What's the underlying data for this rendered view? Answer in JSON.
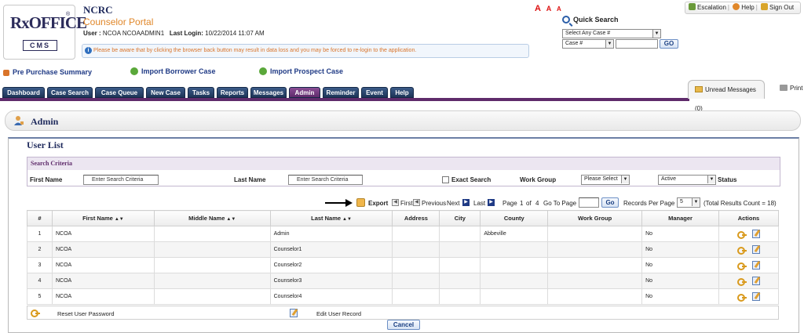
{
  "header": {
    "logo_text": "RxOFFICE",
    "logo_sub": "CMS",
    "org": "NCRC",
    "portal": "Counselor Portal",
    "user_label": "User :",
    "user_value": "NCOA NCOAADMIN1",
    "last_login_label": "Last Login:",
    "last_login_value": "10/22/2014 11:07 AM",
    "notice": "Please be aware that by clicking the browser back button may result in data loss and you may be forced to re-login to the application.",
    "font_sizes": [
      "A",
      "A",
      "A"
    ]
  },
  "quick_search": {
    "title": "Quick Search",
    "case_select": "Select Any Case #",
    "field_select": "Case #",
    "go": "GO"
  },
  "top_links": {
    "escalation": "Escalation",
    "help": "Help",
    "sign_out": "Sign Out"
  },
  "action_links": {
    "pre_purchase": "Pre Purchase Summary",
    "import_borrower": "Import Borrower Case",
    "import_prospect": "Import Prospect Case"
  },
  "nav": {
    "tabs": [
      "Dashboard",
      "Case Search",
      "Case Queue",
      "New Case",
      "Tasks",
      "Reports",
      "Messages",
      "Admin",
      "Reminder",
      "Event",
      "Help"
    ],
    "active": "Admin",
    "unread": "Unread Messages (0)",
    "print": "Print"
  },
  "page": {
    "title": "Admin",
    "section_title": "User List"
  },
  "criteria": {
    "heading": "Search Criteria",
    "first_name_label": "First Name",
    "first_name_value": "Enter Search Criteria",
    "last_name_label": "Last Name",
    "last_name_value": "Enter Search Criteria",
    "exact_search": "Exact Search",
    "work_group_label": "Work Group",
    "work_group_value": "Please Select",
    "status_value": "Active",
    "status_label": "Status"
  },
  "pager": {
    "export": "Export",
    "first": "First",
    "previous": "Previous",
    "next": "Next",
    "last": "Last",
    "page_label": "Page",
    "page_current": "1",
    "of_label": "of",
    "page_total": "4",
    "goto_label": "Go To Page",
    "go": "Go",
    "records_label": "Records Per Page",
    "records_value": "5",
    "total": "(Total Results Count = 18)"
  },
  "table": {
    "headers": [
      "#",
      "First Name",
      "Middle Name",
      "Last Name",
      "Address",
      "City",
      "County",
      "Work Group",
      "Manager",
      "Actions"
    ],
    "rows": [
      {
        "num": "1",
        "first": "NCOA",
        "middle": "",
        "last": "Admin",
        "address": "",
        "city": "",
        "county": "Abbeville",
        "group": "",
        "manager": "No"
      },
      {
        "num": "2",
        "first": "NCOA",
        "middle": "",
        "last": "Counselor1",
        "address": "",
        "city": "",
        "county": "",
        "group": "",
        "manager": "No"
      },
      {
        "num": "3",
        "first": "NCOA",
        "middle": "",
        "last": "Counselor2",
        "address": "",
        "city": "",
        "county": "",
        "group": "",
        "manager": "No"
      },
      {
        "num": "4",
        "first": "NCOA",
        "middle": "",
        "last": "Counselor3",
        "address": "",
        "city": "",
        "county": "",
        "group": "",
        "manager": "No"
      },
      {
        "num": "5",
        "first": "NCOA",
        "middle": "",
        "last": "Counselor4",
        "address": "",
        "city": "",
        "county": "",
        "group": "",
        "manager": "No"
      }
    ]
  },
  "legend": {
    "reset": "Reset User Password",
    "edit": "Edit User Record"
  },
  "cancel": "Cancel",
  "colors": {
    "nav_tab": "#1d3558",
    "nav_active": "#5f2b6b",
    "portal_orange": "#e0872a",
    "link_blue": "#1f3a85"
  }
}
